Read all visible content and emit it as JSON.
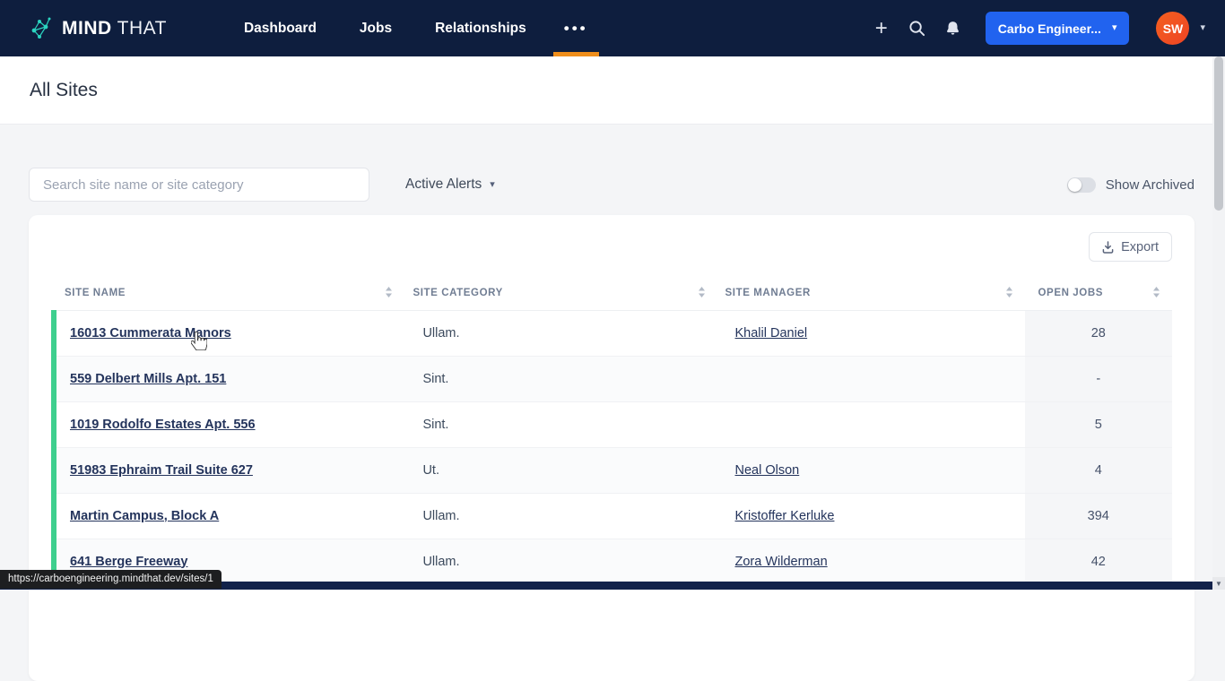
{
  "navbar": {
    "brand_mind": "MIND",
    "brand_that": "THAT",
    "items": [
      {
        "label": "Dashboard"
      },
      {
        "label": "Jobs"
      },
      {
        "label": "Relationships"
      }
    ],
    "more_icon": "•••",
    "org_button_label": "Carbo Engineer...",
    "avatar_initials": "SW"
  },
  "icons": {
    "plus": "+",
    "caret_down": "▾",
    "scroll_down_arrow": "▼"
  },
  "page": {
    "title": "All Sites"
  },
  "filters": {
    "search_placeholder": "Search site name or site category",
    "alerts_dropdown_value": "Active Alerts",
    "show_archived_label": "Show Archived",
    "show_archived_state": "off"
  },
  "table": {
    "export_label": "Export",
    "columns": [
      "Site Name",
      "Site Category",
      "Site Manager",
      "Open Jobs"
    ],
    "rows": [
      {
        "name": "16013 Cummerata Manors",
        "category": "Ullam.",
        "manager": "Khalil Daniel",
        "open_jobs": "28"
      },
      {
        "name": "559 Delbert Mills Apt. 151",
        "category": "Sint.",
        "manager": "",
        "open_jobs": "-"
      },
      {
        "name": "1019 Rodolfo Estates Apt. 556",
        "category": "Sint.",
        "manager": "",
        "open_jobs": "5"
      },
      {
        "name": "51983 Ephraim Trail Suite 627",
        "category": "Ut.",
        "manager": "Neal Olson",
        "open_jobs": "4"
      },
      {
        "name": "Martin Campus, Block A",
        "category": "Ullam.",
        "manager": "Kristoffer Kerluke",
        "open_jobs": "394"
      },
      {
        "name": "641 Berge Freeway",
        "category": "Ullam.",
        "manager": "Zora Wilderman",
        "open_jobs": "42"
      }
    ]
  },
  "status": {
    "url_tooltip": "https://carboengineering.mindthat.dev/sites/1"
  },
  "colors": {
    "navbar_bg": "#0e1e3e",
    "active_tab_underline": "#ef8e1b",
    "org_button_bg": "#2163ef",
    "avatar_bg": "#f4581c",
    "row_accent": "#3ecf8e",
    "link": "#24345c"
  }
}
